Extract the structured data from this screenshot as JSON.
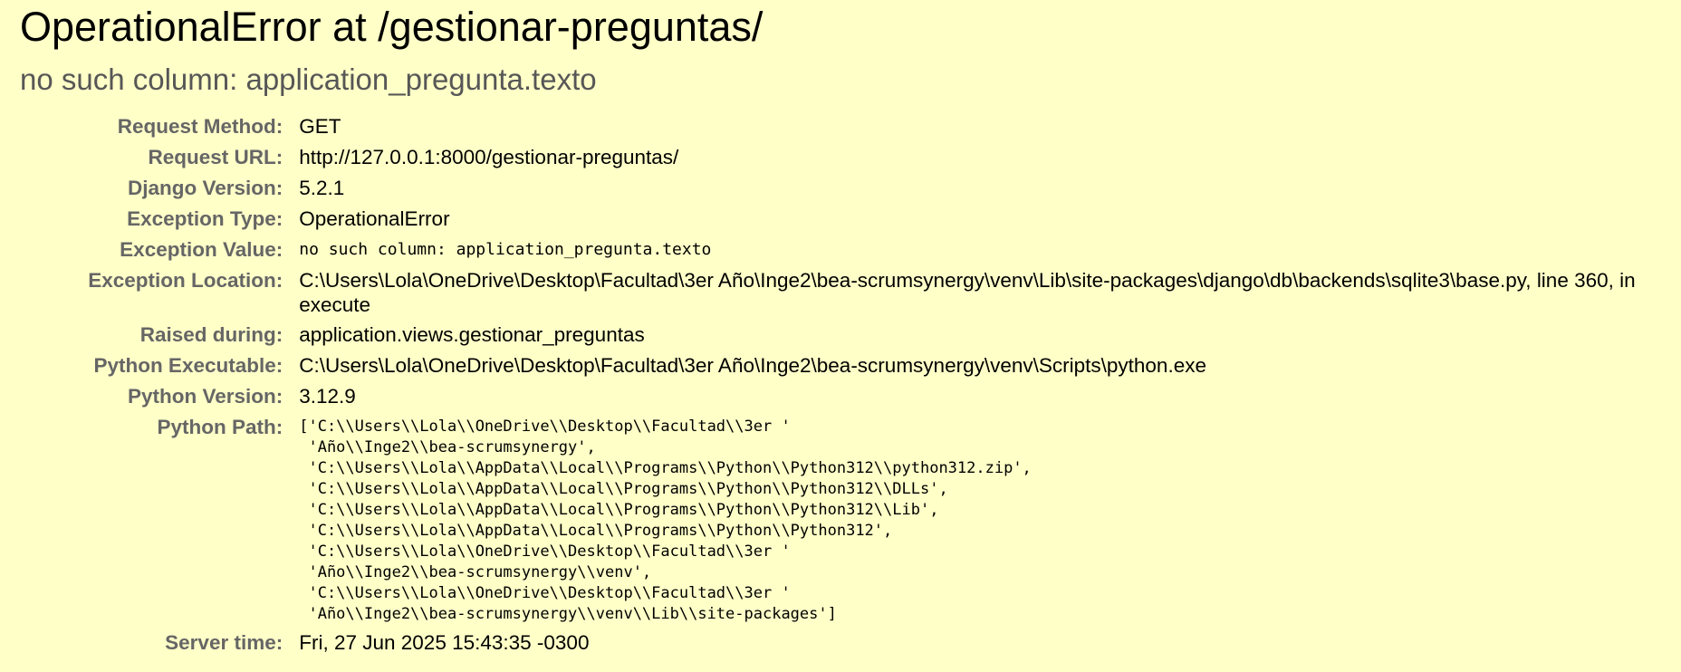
{
  "header": {
    "title": "OperationalError at /gestionar-preguntas/",
    "subtitle": "no such column: application_pregunta.texto"
  },
  "meta": [
    {
      "label": "Request Method:",
      "value": "GET"
    },
    {
      "label": "Request URL:",
      "value": "http://127.0.0.1:8000/gestionar-preguntas/"
    },
    {
      "label": "Django Version:",
      "value": "5.2.1"
    },
    {
      "label": "Exception Type:",
      "value": "OperationalError"
    },
    {
      "label": "Exception Value:",
      "value": "no such column: application_pregunta.texto"
    },
    {
      "label": "Exception Location:",
      "value": "C:\\Users\\Lola\\OneDrive\\Desktop\\Facultad\\3er Año\\Inge2\\bea-scrumsynergy\\venv\\Lib\\site-packages\\django\\db\\backends\\sqlite3\\base.py, line 360, in execute"
    },
    {
      "label": "Raised during:",
      "value": "application.views.gestionar_preguntas"
    },
    {
      "label": "Python Executable:",
      "value": "C:\\Users\\Lola\\OneDrive\\Desktop\\Facultad\\3er Año\\Inge2\\bea-scrumsynergy\\venv\\Scripts\\python.exe"
    },
    {
      "label": "Python Version:",
      "value": "3.12.9"
    },
    {
      "label": "Python Path:",
      "lines": [
        "['C:\\\\Users\\\\Lola\\\\OneDrive\\\\Desktop\\\\Facultad\\\\3er '",
        " 'Año\\\\Inge2\\\\bea-scrumsynergy',",
        " 'C:\\\\Users\\\\Lola\\\\AppData\\\\Local\\\\Programs\\\\Python\\\\Python312\\\\python312.zip',",
        " 'C:\\\\Users\\\\Lola\\\\AppData\\\\Local\\\\Programs\\\\Python\\\\Python312\\\\DLLs',",
        " 'C:\\\\Users\\\\Lola\\\\AppData\\\\Local\\\\Programs\\\\Python\\\\Python312\\\\Lib',",
        " 'C:\\\\Users\\\\Lola\\\\AppData\\\\Local\\\\Programs\\\\Python\\\\Python312',",
        " 'C:\\\\Users\\\\Lola\\\\OneDrive\\\\Desktop\\\\Facultad\\\\3er '",
        " 'Año\\\\Inge2\\\\bea-scrumsynergy\\\\venv',",
        " 'C:\\\\Users\\\\Lola\\\\OneDrive\\\\Desktop\\\\Facultad\\\\3er '",
        " 'Año\\\\Inge2\\\\bea-scrumsynergy\\\\venv\\\\Lib\\\\site-packages']"
      ]
    },
    {
      "label": "Server time:",
      "value": "Fri, 27 Jun 2025 15:43:35 -0300"
    }
  ]
}
